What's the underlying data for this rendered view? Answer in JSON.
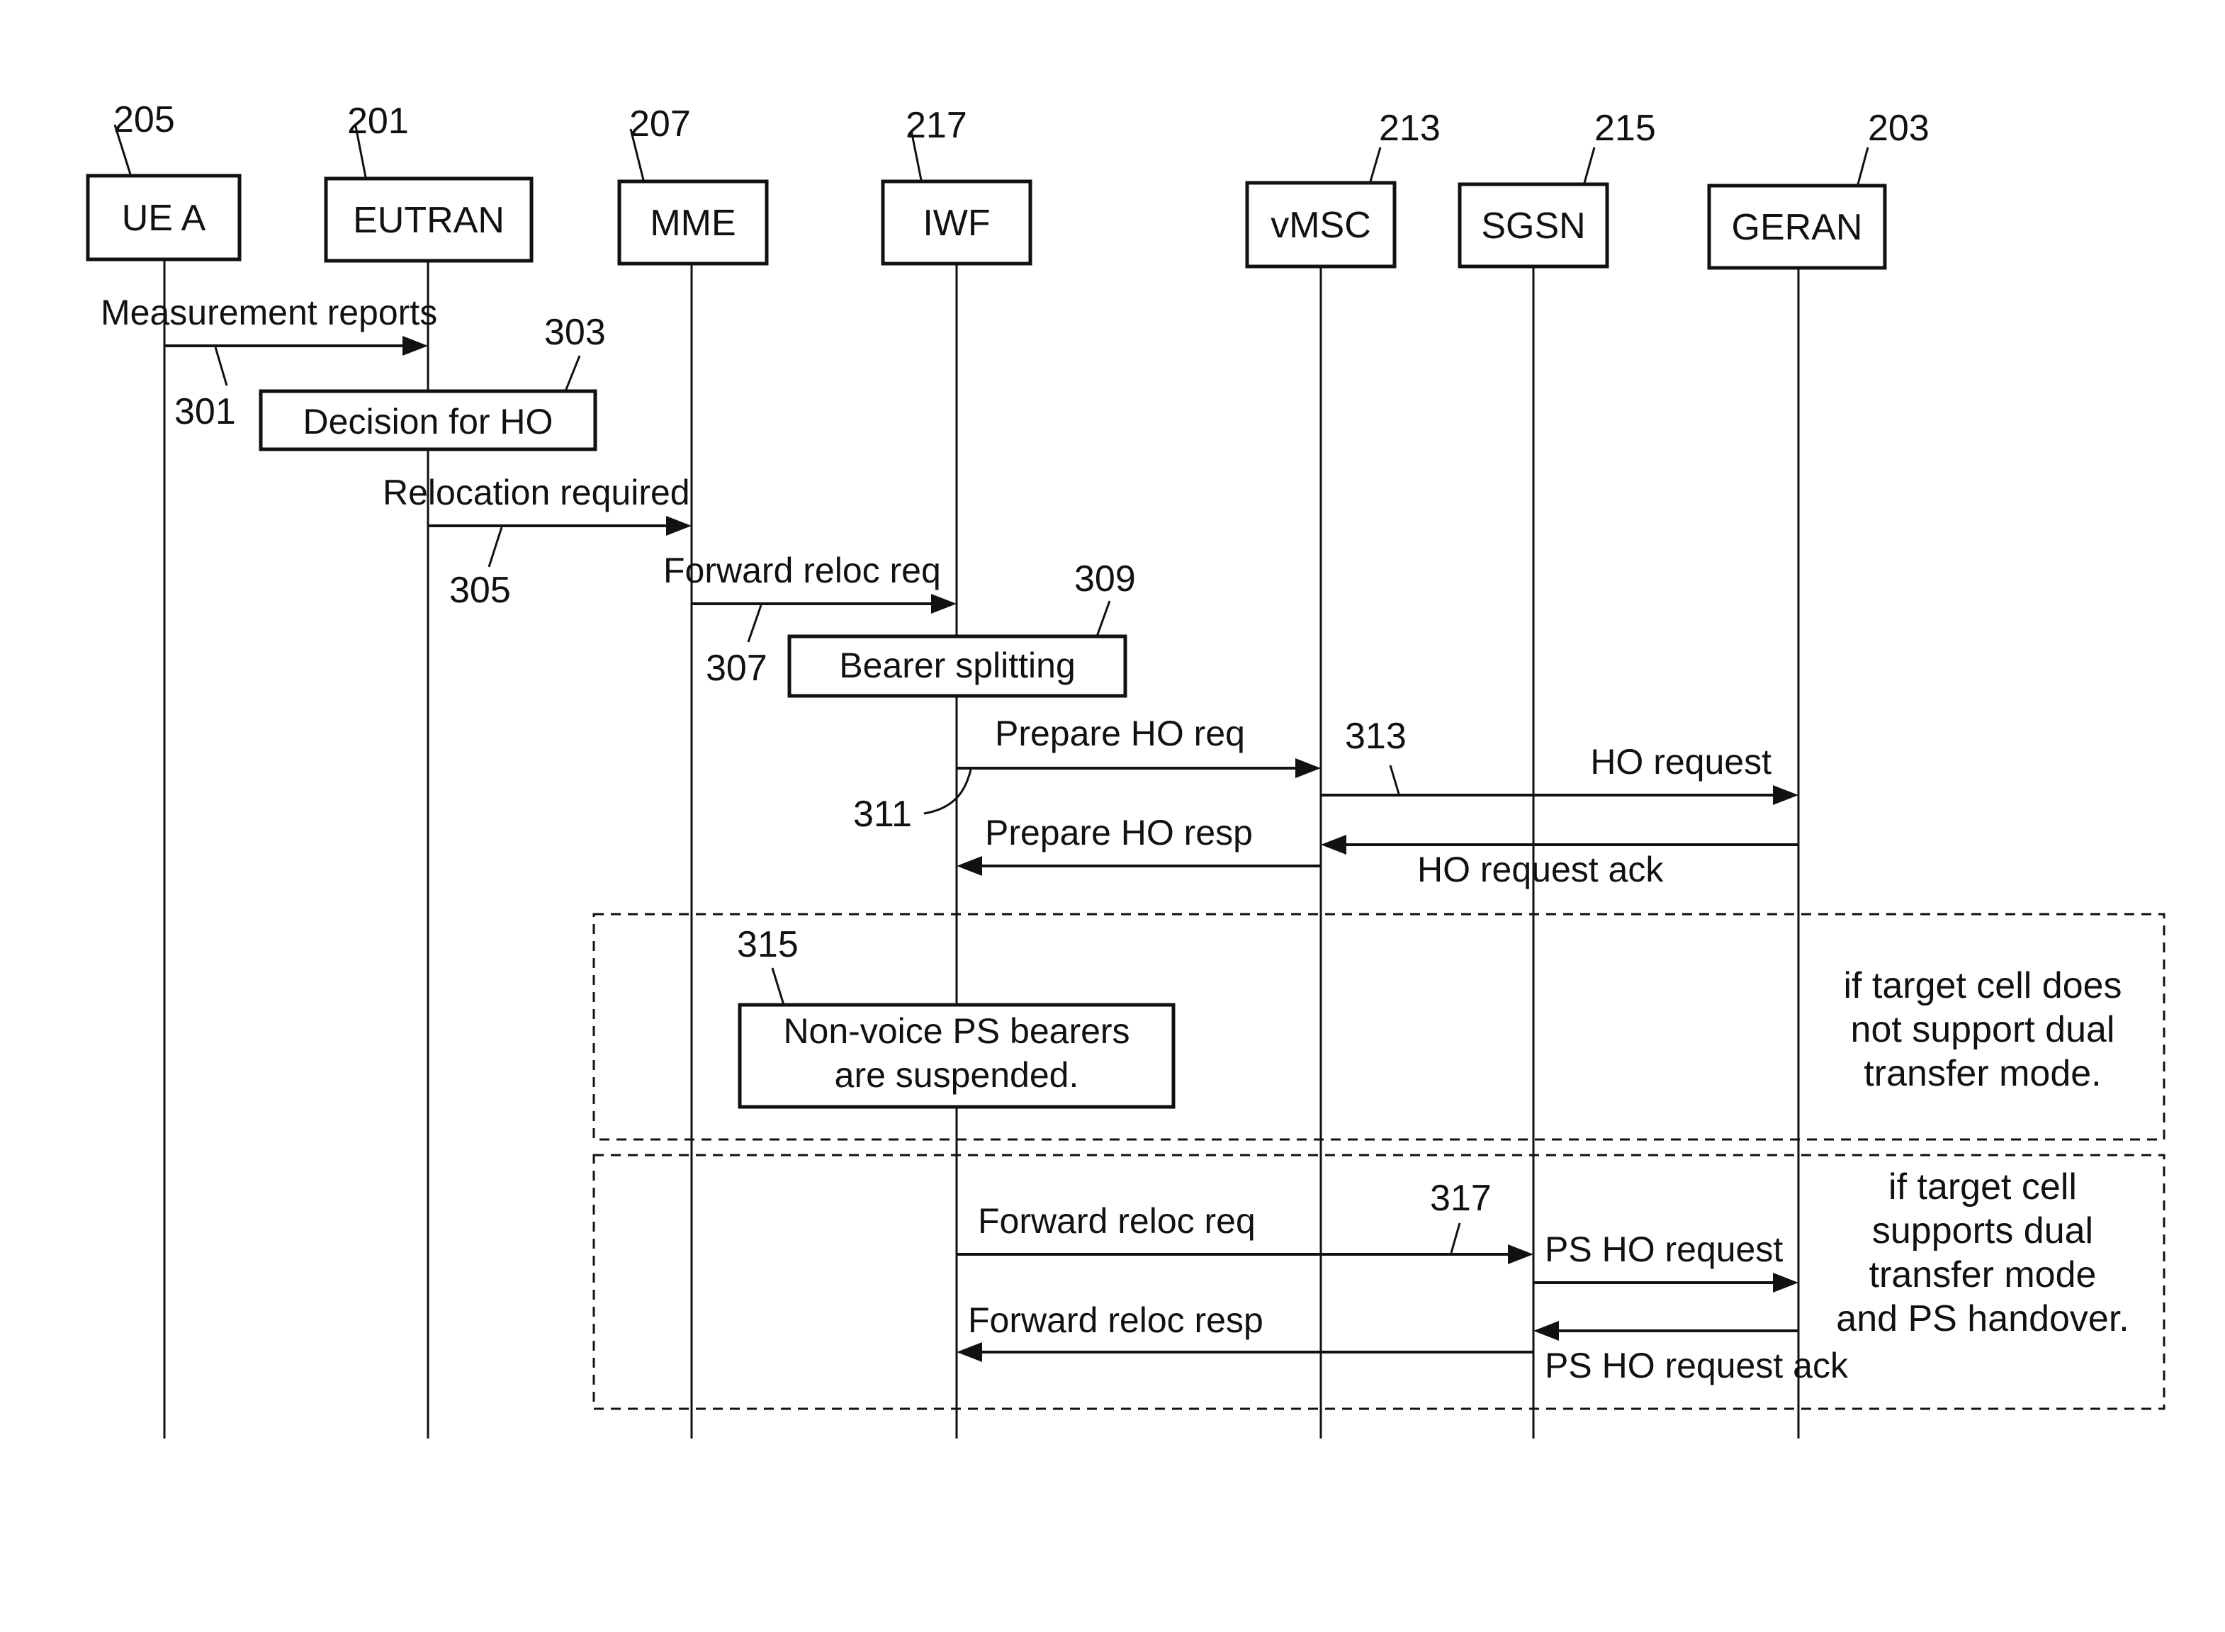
{
  "diagram": {
    "type": "sequence-diagram",
    "colors": {
      "line": "#111111",
      "background": "#ffffff"
    },
    "entities": [
      {
        "id": "ue",
        "label": "UE A",
        "ref": "205"
      },
      {
        "id": "eutran",
        "label": "EUTRAN",
        "ref": "201"
      },
      {
        "id": "mme",
        "label": "MME",
        "ref": "207"
      },
      {
        "id": "iwf",
        "label": "IWF",
        "ref": "217"
      },
      {
        "id": "vmsc",
        "label": "vMSC",
        "ref": "213"
      },
      {
        "id": "sgsn",
        "label": "SGSN",
        "ref": "215"
      },
      {
        "id": "geran",
        "label": "GERAN",
        "ref": "203"
      }
    ],
    "messages": [
      {
        "label": "Measurement reports",
        "from": "ue",
        "to": "eutran",
        "ref": "301"
      },
      {
        "label": "Relocation required",
        "from": "eutran",
        "to": "mme",
        "ref": "305"
      },
      {
        "label": "Forward reloc req",
        "from": "mme",
        "to": "iwf",
        "ref": "307"
      },
      {
        "label": "Prepare HO req",
        "from": "iwf",
        "to": "vmsc",
        "ref": "311"
      },
      {
        "label": "HO request",
        "from": "vmsc",
        "to": "geran",
        "ref": "313"
      },
      {
        "label": "HO request ack",
        "from": "geran",
        "to": "vmsc"
      },
      {
        "label": "Prepare HO resp",
        "from": "vmsc",
        "to": "iwf"
      },
      {
        "label": "Forward reloc req",
        "from": "iwf",
        "to": "sgsn",
        "ref": "317"
      },
      {
        "label": "PS HO request",
        "from": "sgsn",
        "to": "geran"
      },
      {
        "label": "PS HO request ack",
        "from": "geran",
        "to": "sgsn"
      },
      {
        "label": "Forward reloc resp",
        "from": "sgsn",
        "to": "iwf"
      }
    ],
    "actions": [
      {
        "label": "Decision for HO",
        "ref": "303"
      },
      {
        "label": "Bearer splitting",
        "ref": "309"
      },
      {
        "lines": [
          "Non-voice PS bearers",
          "are suspended."
        ],
        "ref": "315"
      }
    ],
    "conditions": [
      {
        "lines": [
          "if target cell does",
          "not support dual",
          "transfer mode."
        ]
      },
      {
        "lines": [
          "if target cell",
          "supports dual",
          "transfer mode",
          "and PS handover."
        ]
      }
    ]
  }
}
